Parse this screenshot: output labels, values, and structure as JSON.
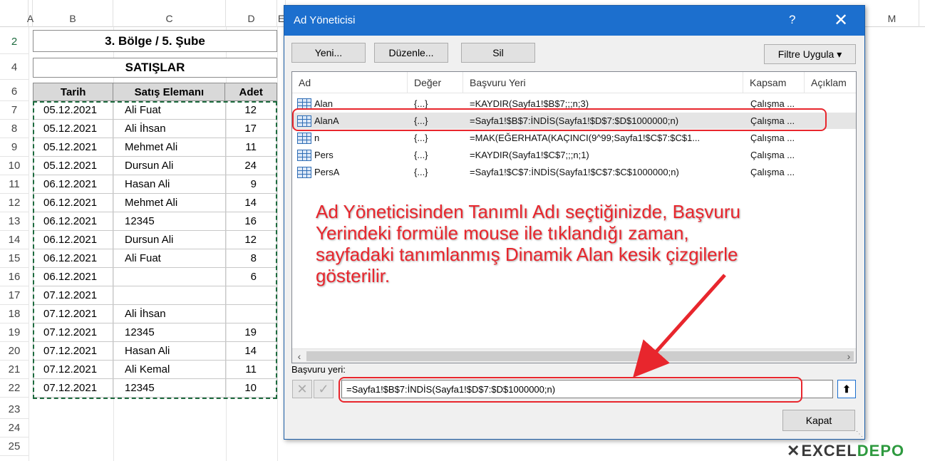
{
  "sheet": {
    "columns": [
      "A",
      "B",
      "C",
      "D",
      "E",
      "M"
    ],
    "rows": [
      "2",
      "4",
      "6",
      "7",
      "8",
      "9",
      "10",
      "11",
      "12",
      "13",
      "14",
      "15",
      "16",
      "17",
      "18",
      "19",
      "20",
      "21",
      "22",
      "23",
      "24",
      "25"
    ],
    "title": "3. Bölge / 5. Şube",
    "subtitle": "SATIŞLAR",
    "headers": [
      "Tarih",
      "Satış Elemanı",
      "Adet"
    ],
    "data": [
      [
        "05.12.2021",
        "Ali Fuat",
        "12"
      ],
      [
        "05.12.2021",
        "Ali İhsan",
        "17"
      ],
      [
        "05.12.2021",
        "Mehmet Ali",
        "11"
      ],
      [
        "05.12.2021",
        "Dursun Ali",
        "24"
      ],
      [
        "06.12.2021",
        "Hasan Ali",
        "9"
      ],
      [
        "06.12.2021",
        "Mehmet Ali",
        "14"
      ],
      [
        "06.12.2021",
        "12345",
        "16"
      ],
      [
        "06.12.2021",
        "Dursun Ali",
        "12"
      ],
      [
        "06.12.2021",
        "Ali Fuat",
        "8"
      ],
      [
        "06.12.2021",
        "",
        "6"
      ],
      [
        "07.12.2021",
        "",
        ""
      ],
      [
        "07.12.2021",
        "Ali İhsan",
        ""
      ],
      [
        "07.12.2021",
        "12345",
        "19"
      ],
      [
        "07.12.2021",
        "Hasan Ali",
        "14"
      ],
      [
        "07.12.2021",
        "Ali Kemal",
        "11"
      ],
      [
        "07.12.2021",
        "12345",
        "10"
      ]
    ]
  },
  "dialog": {
    "title": "Ad Yöneticisi",
    "help": "?",
    "close": "✕",
    "buttons": {
      "new": "Yeni...",
      "edit": "Düzenle...",
      "delete": "Sil",
      "filter": "Filtre Uygula ▾"
    },
    "list_headers": [
      "Ad",
      "Değer",
      "Başvuru Yeri",
      "Kapsam",
      "Açıklam"
    ],
    "names": [
      {
        "name": "Alan",
        "value": "{...}",
        "ref": "=KAYDIR(Sayfa1!$B$7;;;n;3)",
        "scope": "Çalışma ..."
      },
      {
        "name": "AlanA",
        "value": "{...}",
        "ref": "=Sayfa1!$B$7:İNDİS(Sayfa1!$D$7:$D$1000000;n)",
        "scope": "Çalışma ..."
      },
      {
        "name": "n",
        "value": "{...}",
        "ref": "=MAK(EĞERHATA(KAÇINCI(9^99;Sayfa1!$C$7:$C$1...",
        "scope": "Çalışma ..."
      },
      {
        "name": "Pers",
        "value": "{...}",
        "ref": "=KAYDIR(Sayfa1!$C$7;;;n;1)",
        "scope": "Çalışma ..."
      },
      {
        "name": "PersA",
        "value": "{...}",
        "ref": "=Sayfa1!$C$7:İNDİS(Sayfa1!$C$7:$C$1000000;n)",
        "scope": "Çalışma ..."
      }
    ],
    "ref_label": "Başvuru yeri:",
    "ref_value": "=Sayfa1!$B$7:İNDİS(Sayfa1!$D$7:$D$1000000;n)",
    "close_button": "Kapat"
  },
  "annotation": {
    "lines": [
      "Ad Yöneticisinden Tanımlı Adı seçtiğinizde, Başvuru",
      "Yerindeki formüle mouse ile tıklandığı zaman,",
      "sayfadaki tanımlanmış Dinamik Alan kesik çizgilerle",
      "gösterilir."
    ],
    "color": "#e8262d"
  },
  "logo": {
    "part1": "EXCEL",
    "part2": "DEPO"
  },
  "colors": {
    "titlebar": "#1c6fce",
    "accent_green": "#1e6b3f"
  }
}
